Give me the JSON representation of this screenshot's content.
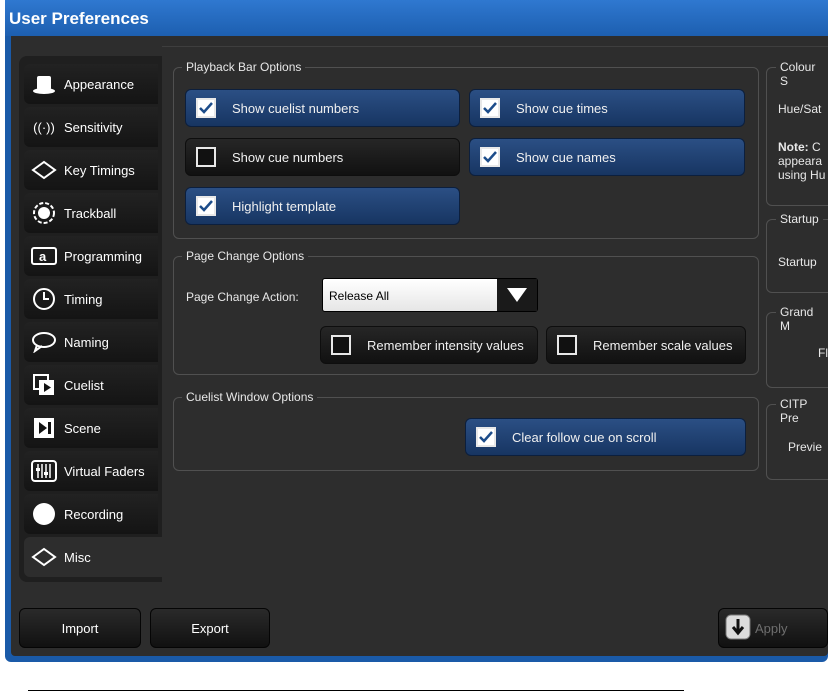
{
  "window": {
    "title": "User Preferences"
  },
  "tabs": [
    {
      "label": "Appearance",
      "icon": "hat-icon"
    },
    {
      "label": "Sensitivity",
      "icon": "signal-icon"
    },
    {
      "label": "Key Timings",
      "icon": "keyboard-icon"
    },
    {
      "label": "Trackball",
      "icon": "trackball-icon"
    },
    {
      "label": "Programming",
      "icon": "programming-icon"
    },
    {
      "label": "Timing",
      "icon": "clock-icon"
    },
    {
      "label": "Naming",
      "icon": "speech-bubble-icon"
    },
    {
      "label": "Cuelist",
      "icon": "cuelist-icon"
    },
    {
      "label": "Scene",
      "icon": "scene-icon"
    },
    {
      "label": "Virtual Faders",
      "icon": "faders-icon"
    },
    {
      "label": "Recording",
      "icon": "record-icon"
    },
    {
      "label": "Misc",
      "icon": "misc-icon"
    }
  ],
  "playback": {
    "title": "Playback Bar Options",
    "show_cuelist_numbers": "Show cuelist numbers",
    "show_cue_times": "Show cue times",
    "show_cue_numbers": "Show cue numbers",
    "show_cue_names": "Show cue names",
    "highlight_template": "Highlight template"
  },
  "page_change": {
    "title": "Page Change Options",
    "action_label": "Page Change Action:",
    "action_value": "Release All",
    "remember_intensity": "Remember intensity values",
    "remember_scale": "Remember scale values"
  },
  "cuelist_window": {
    "title": "Cuelist Window Options",
    "clear_follow": "Clear follow cue on scroll"
  },
  "right": {
    "colour_title": "Colour S",
    "hue": "Hue/Sat",
    "note_bold": "Note:",
    "note_rest": " C",
    "note_line2": "appeara",
    "note_line3": "using Hu",
    "startup_title": "Startup",
    "startup_label": "Startup",
    "grand_title": "Grand M",
    "grand_label": "Fl",
    "citp_title": "CITP Pre",
    "citp_label": "Previe"
  },
  "buttons": {
    "import": "Import",
    "export": "Export",
    "apply": "Apply"
  }
}
